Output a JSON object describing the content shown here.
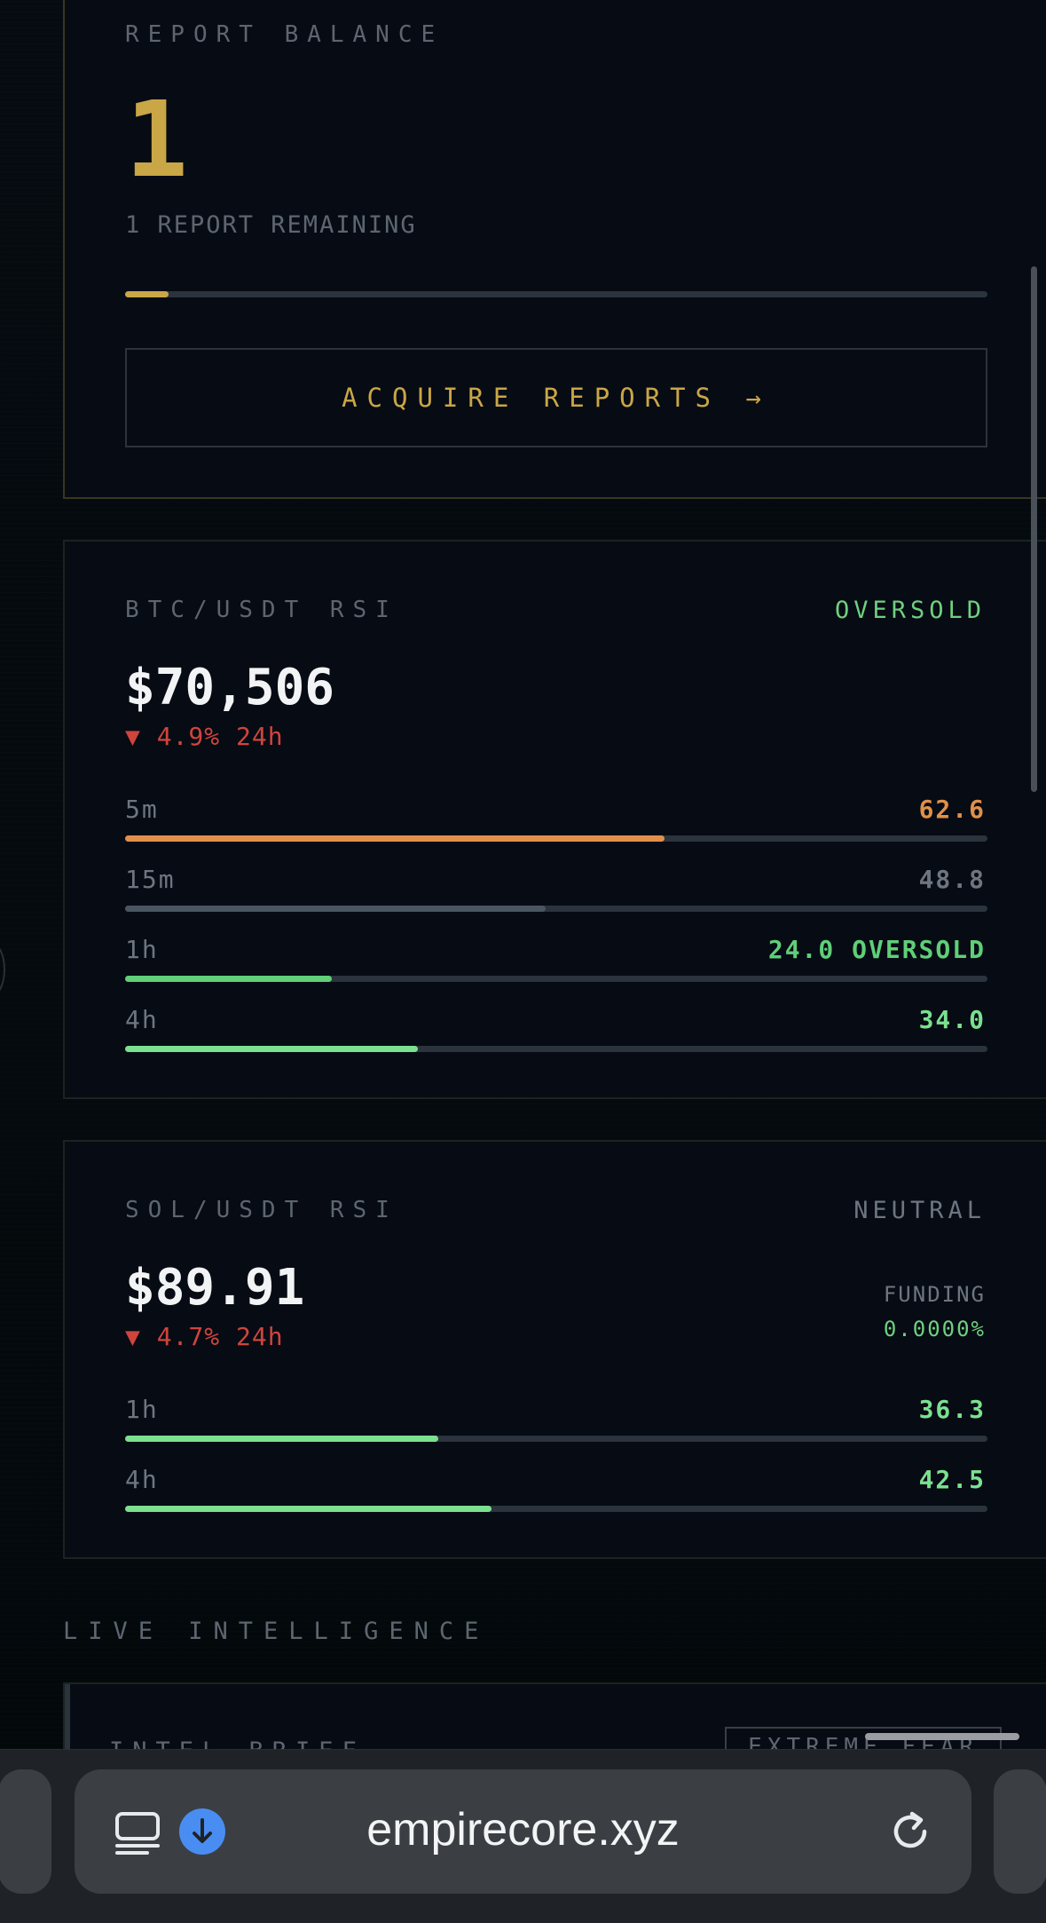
{
  "report": {
    "label": "REPORT BALANCE",
    "count": "1",
    "remaining": "1 REPORT REMAINING",
    "progress_fraction": 0.05,
    "acquire_button": "ACQUIRE REPORTS →"
  },
  "btc": {
    "label": "BTC/USDT RSI",
    "status": "OVERSOLD",
    "price": "$70,506",
    "change": "▼ 4.9% 24h",
    "rows": [
      {
        "tf": "5m",
        "value": "62.6",
        "rsi": 62.6,
        "color": "#e0904a"
      },
      {
        "tf": "15m",
        "value": "48.8",
        "rsi": 48.8,
        "color": "#4a5562"
      },
      {
        "tf": "1h",
        "value": "24.0 OVERSOLD",
        "rsi": 24.0,
        "color": "#5fcf78"
      },
      {
        "tf": "4h",
        "value": "34.0",
        "rsi": 34.0,
        "color": "#7be08f"
      }
    ]
  },
  "sol": {
    "label": "SOL/USDT RSI",
    "status": "NEUTRAL",
    "price": "$89.91",
    "change": "▼ 4.7% 24h",
    "funding_label": "FUNDING",
    "funding_value": "0.0000%",
    "rows": [
      {
        "tf": "1h",
        "value": "36.3",
        "rsi": 36.3,
        "color": "#7be08f"
      },
      {
        "tf": "4h",
        "value": "42.5",
        "rsi": 42.5,
        "color": "#7be08f"
      }
    ]
  },
  "live": {
    "title": "LIVE INTELLIGENCE",
    "intel_label": "INTEL BRIEF",
    "badge": "EXTREME FEAR"
  },
  "browser": {
    "url": "empirecore.xyz",
    "icons": [
      "tabs-icon",
      "download-icon",
      "reload-icon"
    ]
  },
  "colors": {
    "gold": "#c9a646",
    "green": "#6fd07f",
    "red": "#d0443c",
    "muted": "#5d6670"
  }
}
